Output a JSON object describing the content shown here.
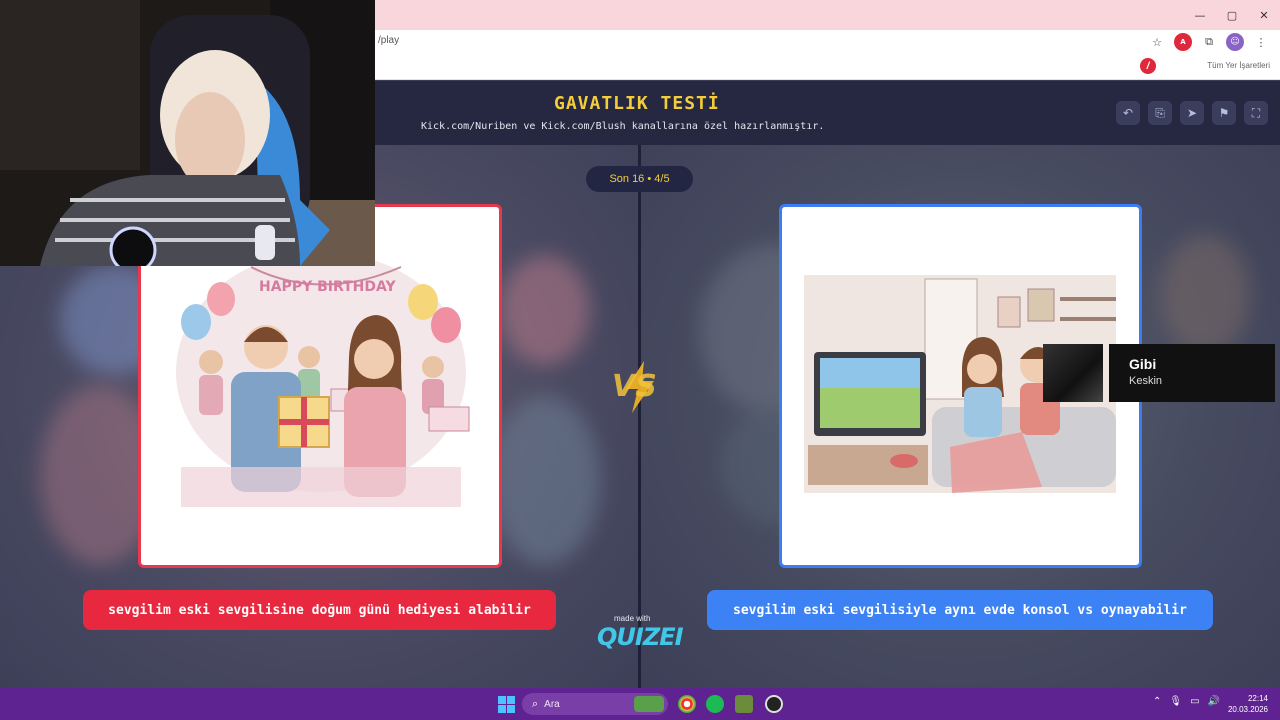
{
  "browser": {
    "url_fragment": "/play",
    "window_controls": [
      "—",
      "▢",
      "✕"
    ],
    "bookmarks_label": "Tüm Yer İşaretleri"
  },
  "page": {
    "title": "GAVATLIK TESTİ",
    "subtitle": "Kick.com/Nuriben ve Kick.com/Blush kanallarına özel hazırlanmıştır.",
    "round_badge": "Son 16 • 4/5",
    "vs_label": "VS",
    "made_with": "made with",
    "brand": "QUIZEI",
    "header_actions": [
      "undo-icon",
      "share-icon",
      "send-icon",
      "flag-icon",
      "fullscreen-icon"
    ]
  },
  "choices": {
    "left": {
      "label": "sevgilim eski sevgilisine doğum günü hediyesi alabilir",
      "image_text": "HAPPY BIRTHDAY",
      "color": "#e8283f"
    },
    "right": {
      "label": "sevgilim eski sevgilisiyle aynı evde konsol vs oynayabilir",
      "color": "#3c82f4"
    }
  },
  "now_playing": {
    "title": "Gibi",
    "artist": "Keskin"
  },
  "taskbar": {
    "search_placeholder": "Ara",
    "time": "22:14",
    "date": "20.03.2026"
  },
  "colors": {
    "accent_yellow": "#f5cd3b",
    "header_bg": "#252840",
    "taskbar_bg": "#5e2390"
  }
}
